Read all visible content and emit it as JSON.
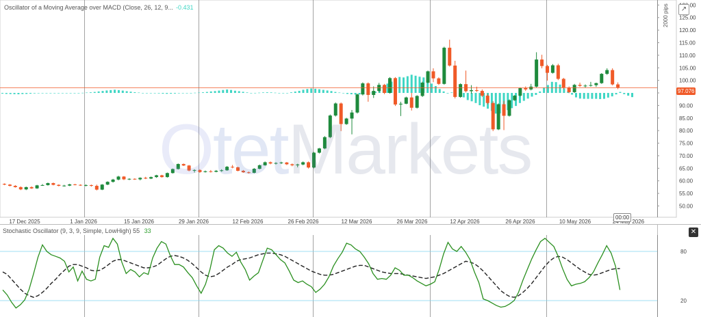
{
  "main": {
    "title": "Oscillator of a Moving Average over MACD (Close, 26, 12, 9...",
    "value": "-0.431",
    "pips_label": "2000 pips",
    "current_price": "97.076",
    "time_tag": "00:00",
    "watermark": "OtetMarkets"
  },
  "stoch": {
    "title": "Stochastic Oscillator (9, 3, 9, Simple, LowHigh)",
    "value1": "55",
    "value2": "33"
  },
  "colors": {
    "up": "#1e8a3c",
    "down": "#f05a28",
    "hist": "#3fd6c4",
    "k": "#2a8f1f",
    "d": "#222222",
    "level": "#7fd4ef",
    "price_line": "#f05a28"
  },
  "chart_data": [
    {
      "type": "candlestick",
      "x_labels": [
        "17 Dec 2025",
        "1 Jan 2026",
        "15 Jan 2026",
        "29 Jan 2026",
        "12 Feb 2026",
        "26 Feb 2026",
        "12 Mar 2026",
        "26 Mar 2026",
        "12 Apr 2026",
        "26 Apr 2026",
        "10 May 2026",
        "24 May 2026"
      ],
      "y_ticks": [
        50,
        55,
        60,
        65,
        70,
        75,
        80,
        85,
        90,
        95,
        100,
        105,
        110,
        115,
        120,
        125,
        130
      ],
      "y_tick_suffix": ".00",
      "ylim": [
        45.5,
        132
      ],
      "current_price": 97.076,
      "candles": [
        [
          58.8,
          59,
          58.3,
          58.5
        ],
        [
          58.5,
          58.7,
          57.8,
          58
        ],
        [
          58,
          58.3,
          57.3,
          57.5
        ],
        [
          57.5,
          57.8,
          56.3,
          56.6
        ],
        [
          56.6,
          57.7,
          56.3,
          57.5
        ],
        [
          57.5,
          57.8,
          56.8,
          57
        ],
        [
          57,
          58.4,
          56.8,
          58.2
        ],
        [
          58.2,
          58.7,
          58,
          58.3
        ],
        [
          58.3,
          59.3,
          58.1,
          59.1
        ],
        [
          59.1,
          59.3,
          58.2,
          58.4
        ],
        [
          58.4,
          58.6,
          57.8,
          58
        ],
        [
          58,
          58.4,
          57.7,
          58.1
        ],
        [
          58.1,
          58.8,
          57.9,
          58.6
        ],
        [
          58.6,
          58.8,
          58.2,
          58.4
        ],
        [
          58.4,
          58.6,
          58,
          58.2
        ],
        [
          58.2,
          58.6,
          57.8,
          58.3
        ],
        [
          58.3,
          58.5,
          57.7,
          58
        ],
        [
          58,
          58.5,
          56.2,
          56.5
        ],
        [
          56.5,
          58.7,
          56.3,
          58.5
        ],
        [
          58.5,
          59.8,
          58.3,
          59.6
        ],
        [
          59.6,
          60.8,
          59.3,
          60.5
        ],
        [
          60.5,
          62,
          60.2,
          61.7
        ],
        [
          61.7,
          61.9,
          60.3,
          60.6
        ],
        [
          60.6,
          61,
          60.3,
          60.8
        ],
        [
          60.8,
          61,
          60.4,
          60.6
        ],
        [
          60.6,
          61.4,
          60.2,
          61.2
        ],
        [
          61.2,
          61.6,
          60.7,
          60.9
        ],
        [
          60.9,
          61.7,
          60.7,
          61.5
        ],
        [
          61.5,
          62.4,
          61.2,
          62.2
        ],
        [
          62.2,
          62.4,
          61.3,
          61.5
        ],
        [
          61.5,
          63.3,
          61.3,
          63.1
        ],
        [
          63.1,
          64.9,
          62.9,
          64.7
        ],
        [
          64.7,
          66.9,
          64.5,
          66.7
        ],
        [
          66.7,
          66.9,
          65.9,
          66.1
        ],
        [
          66.1,
          66.3,
          63.8,
          64.1
        ],
        [
          64.1,
          64.6,
          63.3,
          64.3
        ],
        [
          64.3,
          64.6,
          63.2,
          63.5
        ],
        [
          63.5,
          64.1,
          63.3,
          63.8
        ],
        [
          63.8,
          64.3,
          63.3,
          63.6
        ],
        [
          63.6,
          64.3,
          63.4,
          64
        ],
        [
          64,
          64.6,
          63.6,
          64.2
        ],
        [
          64.2,
          65.9,
          64,
          65.6
        ],
        [
          65.6,
          66.3,
          65,
          65.4
        ],
        [
          65.4,
          65.6,
          63.8,
          64
        ],
        [
          64,
          64.3,
          63.2,
          63.4
        ],
        [
          63.4,
          63.7,
          62.9,
          63.2
        ],
        [
          63.2,
          65.1,
          63,
          64.8
        ],
        [
          64.8,
          66.5,
          64.6,
          66.2
        ],
        [
          66.2,
          67.7,
          66,
          67.4
        ],
        [
          67.4,
          67.7,
          66.6,
          66.9
        ],
        [
          66.9,
          67.4,
          66.5,
          67.1
        ],
        [
          67.1,
          67.6,
          66.7,
          67.3
        ],
        [
          67.3,
          67.5,
          66.3,
          66.6
        ],
        [
          66.6,
          66.9,
          65.8,
          66.2
        ],
        [
          66.2,
          66.8,
          65.4,
          66.5
        ],
        [
          66.5,
          67.7,
          66.2,
          67.4
        ],
        [
          67.4,
          67.7,
          64.9,
          65.3
        ],
        [
          65.3,
          71.5,
          65,
          71.2
        ],
        [
          71.2,
          73.1,
          70.9,
          72.9
        ],
        [
          72.9,
          77.8,
          72.6,
          77.4
        ],
        [
          77.4,
          86.4,
          77,
          86
        ],
        [
          86,
          91.2,
          85.6,
          90.8
        ],
        [
          90.8,
          91.2,
          79.8,
          82.6
        ],
        [
          82.6,
          85.1,
          82.3,
          84.8
        ],
        [
          84.8,
          88.2,
          78.5,
          87.2
        ],
        [
          87.2,
          94.7,
          86.8,
          94.4
        ],
        [
          94.4,
          99.2,
          94,
          98.8
        ],
        [
          98.8,
          99.2,
          91.5,
          94.2
        ],
        [
          94.2,
          97.6,
          93,
          95.8
        ],
        [
          95.8,
          99,
          95.2,
          98.2
        ],
        [
          98.2,
          98.6,
          94.5,
          95
        ],
        [
          95,
          101.3,
          94.7,
          100.9
        ],
        [
          100.9,
          101.3,
          89.8,
          90.4
        ],
        [
          90.4,
          91.5,
          85.8,
          90.7
        ],
        [
          90.7,
          93.5,
          90.5,
          93.2
        ],
        [
          93.2,
          95,
          88,
          89.1
        ],
        [
          89.1,
          94.1,
          88.8,
          93.8
        ],
        [
          93.8,
          99.5,
          93.4,
          99.1
        ],
        [
          99.1,
          103.9,
          98.8,
          103.6
        ],
        [
          103.6,
          104.8,
          99.3,
          100.8
        ],
        [
          100.8,
          101.2,
          98.2,
          98.6
        ],
        [
          98.6,
          113.4,
          98.3,
          113
        ],
        [
          113,
          116.2,
          105.5,
          105.9
        ],
        [
          105.9,
          107.8,
          92.8,
          93.4
        ],
        [
          93.4,
          98.8,
          93.1,
          98.5
        ],
        [
          98.5,
          103.9,
          95.2,
          95.7
        ],
        [
          95.7,
          98.1,
          94.7,
          96.1
        ],
        [
          96.1,
          97.5,
          95.4,
          95.8
        ],
        [
          95.8,
          96.4,
          93.4,
          93.9
        ],
        [
          93.9,
          94.6,
          90.4,
          91
        ],
        [
          91,
          91.7,
          79.8,
          80.5
        ],
        [
          80.5,
          90.8,
          80.2,
          90.5
        ],
        [
          90.5,
          91.8,
          80.2,
          85.9
        ],
        [
          85.9,
          92.4,
          85.6,
          92.1
        ],
        [
          92.1,
          94.2,
          91.8,
          93.9
        ],
        [
          93.9,
          97.2,
          93.6,
          96.9
        ],
        [
          96.9,
          97.6,
          95.8,
          96.4
        ],
        [
          96.4,
          98.6,
          96,
          97.5
        ],
        [
          97.5,
          111.2,
          97.2,
          108.3
        ],
        [
          108.3,
          110.2,
          104.8,
          105.7
        ],
        [
          105.7,
          106.2,
          99.9,
          103
        ],
        [
          103,
          106.5,
          102.7,
          106
        ],
        [
          106,
          106.6,
          100.1,
          100.6
        ],
        [
          100.6,
          101,
          96.5,
          97.1
        ],
        [
          97.1,
          97.6,
          94.9,
          95.3
        ],
        [
          95.3,
          98.6,
          95,
          98.2
        ],
        [
          98.2,
          99.1,
          97.4,
          97.8
        ],
        [
          97.8,
          98.4,
          97.2,
          97.9
        ],
        [
          97.9,
          99.4,
          97.5,
          98.1
        ],
        [
          98.1,
          99.1,
          97.4,
          98.9
        ],
        [
          98.9,
          102.9,
          98.6,
          102.6
        ],
        [
          102.6,
          104.8,
          102.2,
          104.1
        ],
        [
          104.1,
          104.8,
          98,
          98.4
        ],
        [
          98.4,
          99.2,
          96.5,
          97.1
        ]
      ],
      "histogram": [
        -0.3,
        -0.4,
        -0.45,
        -0.5,
        -0.55,
        -0.45,
        -0.4,
        -0.3,
        -0.2,
        -0.15,
        -0.1,
        -0.08,
        -0.05,
        -0.03,
        0,
        -0.05,
        -0.07,
        -0.05,
        -0.03,
        0,
        0.05,
        0.15,
        0.25,
        0.4,
        0.6,
        0.8,
        1,
        1.15,
        1.3,
        1.15,
        0.95,
        0.7,
        0.5,
        0.3,
        0.15,
        0,
        0,
        -0.05,
        -0.1,
        -0.2,
        -0.3,
        -0.35,
        -0.3,
        -0.25,
        -0.15,
        -0.1,
        -0.05,
        0,
        0.08,
        0.15,
        0.25,
        0.4,
        0.6,
        0.75,
        0.95,
        1.2,
        1.4,
        1.2,
        0.9,
        0.7,
        0.45,
        0.2,
        0,
        0.02,
        0.1,
        0.2,
        0.25,
        0.2,
        0.1,
        0,
        -0.05,
        0,
        0.25,
        0.55,
        0.85,
        1.3,
        1.6,
        1.8,
        1.7,
        1.5,
        1.25,
        1,
        0.75,
        0.4,
        0.15,
        -0.15,
        -0.4,
        -0.55,
        -0.65,
        -0.6,
        -0.45,
        -0.2,
        0.1,
        0.5,
        1.5,
        2.8,
        3.8,
        4.6,
        5.9,
        6.5,
        6.3,
        6.8,
        7.4,
        7,
        6.6,
        6.3,
        5.2,
        3.8,
        2.8,
        1.6,
        0.6,
        -0.2,
        0.2,
        -0.3,
        -1.2,
        -1.8,
        -2.9,
        -3.4,
        -4.1,
        -5,
        -5.6,
        -6.4,
        -7.3,
        -8.4,
        -8.3,
        -8.1,
        -7,
        -6.2,
        -5.3,
        -4.1,
        -3.2,
        -2.3,
        -1.5,
        -0.8,
        0.6,
        2.1,
        3.2,
        4.5,
        4.4,
        3.4,
        1.9,
        0.6,
        -0.7,
        -1.8,
        -2.3,
        -2.4,
        -2.4,
        -2.4,
        -2.4,
        -2.5,
        -2.4,
        -1.9,
        -1.4,
        -0.6,
        0.4,
        -0.5,
        -1.1,
        -1.7
      ]
    },
    {
      "type": "line",
      "name": "Stochastic Oscillator (9, 3, 9, Simple, LowHigh)",
      "y_levels": [
        80,
        20
      ],
      "ylim": [
        0,
        100
      ],
      "series": [
        {
          "key": "K",
          "values": [
            33,
            27,
            18,
            11,
            15,
            21,
            34,
            53,
            73,
            88,
            80,
            76,
            74,
            72,
            68,
            55,
            61,
            44,
            56,
            46,
            44,
            46,
            73,
            87,
            85,
            96,
            89,
            67,
            53,
            58,
            55,
            49,
            54,
            52,
            72,
            84,
            92,
            89,
            75,
            64,
            64,
            61,
            54,
            48,
            38,
            29,
            40,
            58,
            82,
            87,
            84,
            78,
            74,
            79,
            67,
            58,
            45,
            50,
            54,
            69,
            84,
            82,
            76,
            70,
            66,
            56,
            45,
            42,
            44,
            40,
            37,
            30,
            34,
            40,
            49,
            62,
            71,
            79,
            90,
            88,
            83,
            80,
            73,
            65,
            53,
            46,
            47,
            46,
            51,
            60,
            57,
            51,
            51,
            48,
            44,
            41,
            38,
            40,
            43,
            58,
            77,
            91,
            83,
            80,
            86,
            79,
            70,
            55,
            42,
            22,
            20,
            17,
            14,
            12,
            13,
            16,
            20,
            30,
            45,
            58,
            71,
            82,
            92,
            96,
            91,
            86,
            74,
            59,
            46,
            38,
            40,
            41,
            43,
            48,
            55,
            66,
            76,
            87,
            78,
            62,
            33
          ]
        },
        {
          "key": "D",
          "values": [
            55,
            52,
            46,
            40,
            34,
            29,
            26,
            24,
            26,
            30,
            35,
            41,
            46,
            52,
            57,
            62,
            64,
            64,
            62,
            60,
            57,
            56,
            57,
            60,
            64,
            68,
            70,
            70,
            68,
            66,
            64,
            62,
            60,
            60,
            61,
            63,
            67,
            71,
            74,
            75,
            74,
            72,
            69,
            65,
            60,
            55,
            51,
            49,
            50,
            53,
            57,
            61,
            64,
            68,
            70,
            71,
            72,
            74,
            76,
            77,
            78,
            78,
            77,
            76,
            74,
            71,
            68,
            65,
            62,
            59,
            56,
            54,
            52,
            51,
            51,
            52,
            54,
            56,
            58,
            60,
            62,
            63,
            63,
            61,
            59,
            57,
            55,
            54,
            53,
            53,
            53,
            52,
            51,
            50,
            49,
            48,
            47,
            48,
            49,
            51,
            53,
            56,
            59,
            62,
            65,
            68,
            67,
            65,
            61,
            56,
            50,
            44,
            38,
            32,
            28,
            25,
            24,
            26,
            30,
            35,
            41,
            48,
            55,
            62,
            68,
            72,
            74,
            73,
            70,
            66,
            62,
            58,
            55,
            52,
            51,
            52,
            54,
            56,
            58,
            59,
            59
          ]
        }
      ]
    }
  ]
}
